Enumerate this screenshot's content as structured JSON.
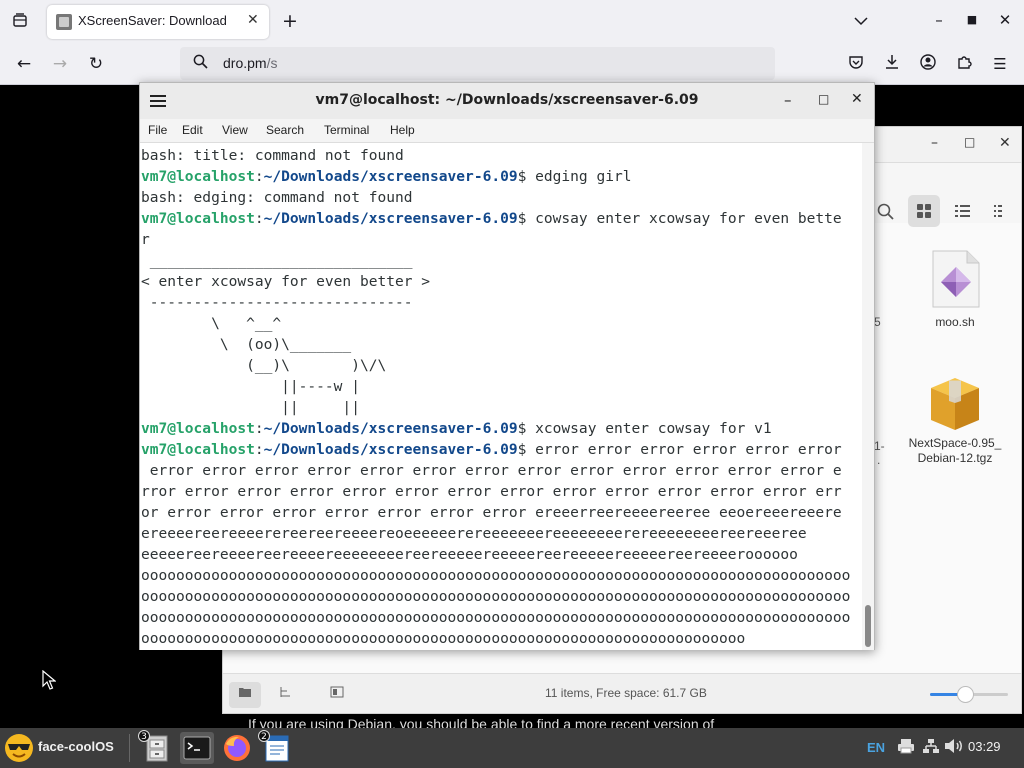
{
  "browser": {
    "tab_title": "XScreenSaver: Download",
    "url_host": "dro.pm",
    "url_path": "/s",
    "page_text": "If you are using Debian, you should be able to find a more recent version of"
  },
  "terminal": {
    "title": "vm7@localhost: ~/Downloads/xscreensaver-6.09",
    "menu": [
      "File",
      "Edit",
      "View",
      "Search",
      "Terminal",
      "Help"
    ],
    "prompt_user": "vm7@localhost",
    "prompt_path": "~/Downloads/xscreensaver-6.09",
    "lines": [
      {
        "text": "bash: title: command not found"
      },
      {
        "prompt": true,
        "text": "edging girl"
      },
      {
        "text": "bash: edging: command not found"
      },
      {
        "prompt": true,
        "text": "cowsay enter xcowsay for even bette"
      },
      {
        "text": "r"
      },
      {
        "text": " ______________________________"
      },
      {
        "text": "< enter xcowsay for even better >"
      },
      {
        "text": " ------------------------------"
      },
      {
        "text": "        \\   ^__^"
      },
      {
        "text": "         \\  (oo)\\_______"
      },
      {
        "text": "            (__)\\       )\\/\\"
      },
      {
        "text": "                ||----w |"
      },
      {
        "text": "                ||     ||"
      },
      {
        "prompt": true,
        "text": "xcowsay enter cowsay for v1"
      },
      {
        "prompt": true,
        "text": "error error error error error error"
      },
      {
        "text": " error error error error error error error error error error error error error e"
      },
      {
        "text": "rror error error error error error error error error error error error error err"
      },
      {
        "text": "or error error error error error error error ereeerreereeeereeree eeoereeereeere"
      },
      {
        "text": "ereeeereereeeerereereereeeereoeeeeeerereeeeeeereeeeeeeerereeeeeeeereereeeree"
      },
      {
        "text": "eeeeereereeeereereeeereeeeeeeereereeeeereeeeereereeeeereeeeereereeeeroooooo"
      },
      {
        "text": "ooooooooooooooooooooooooooooooooooooooooooooooooooooooooooooooooooooooooooooooooo"
      },
      {
        "text": "ooooooooooooooooooooooooooooooooooooooooooooooooooooooooooooooooooooooooooooooooo"
      },
      {
        "text": "ooooooooooooooooooooooooooooooooooooooooooooooooooooooooooooooooooooooooooooooooo"
      },
      {
        "text": "ooooooooooooooooooooooooooooooooooooooooooooooooooooooooooooooooooooo"
      }
    ]
  },
  "file_manager": {
    "status": "11 items, Free space: 61.7 GB",
    "zoom_level": 0.45,
    "files": [
      {
        "name": "moo.sh"
      },
      {
        "name": "NextSpace-0.95_\nDebian-12.tgz"
      }
    ],
    "edge_labels": [
      "5",
      "1-",
      "."
    ]
  },
  "taskbar": {
    "start_label": "face-coolOS",
    "badges": [
      "3",
      "2"
    ],
    "lang": "EN",
    "clock": "03:29"
  },
  "colors": {
    "prompt_user": "#26a269",
    "prompt_path": "#12488b",
    "terminal_text": "#2e3436",
    "taskbar_bg": "#3d3d3d"
  }
}
